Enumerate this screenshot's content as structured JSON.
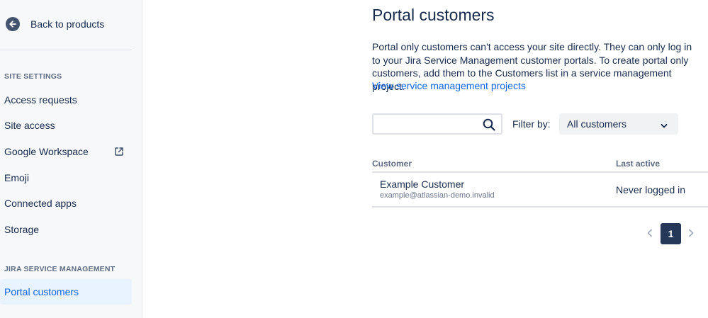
{
  "sidebar": {
    "back_label": "Back to products",
    "sections": [
      {
        "title": "SITE SETTINGS",
        "items": [
          {
            "label": "Access requests"
          },
          {
            "label": "Site access"
          },
          {
            "label": "Google Workspace",
            "icon": "external-link-icon"
          },
          {
            "label": "Emoji"
          },
          {
            "label": "Connected apps"
          },
          {
            "label": "Storage"
          }
        ]
      },
      {
        "title": "JIRA SERVICE MANAGEMENT",
        "items": [
          {
            "label": "Portal customers",
            "active": true
          }
        ]
      }
    ]
  },
  "main": {
    "title": "Portal customers",
    "description": "Portal only customers can't access your site directly. They can only log in to your Jira Service Management customer portals. To create portal only customers, add them to the Customers list in a service management project.",
    "link_label": "View service management projects",
    "search": {
      "placeholder": "",
      "value": ""
    },
    "filter_label": "Filter by:",
    "filter_value": "All customers",
    "table": {
      "headers": [
        "Customer",
        "Last active"
      ],
      "rows": [
        {
          "name": "Example Customer",
          "email": "example@atlassian-demo.invalid",
          "last_active": "Never logged in"
        }
      ]
    },
    "pagination": {
      "current_page": "1"
    }
  },
  "colors": {
    "link": "#0c66e4",
    "active_bg": "#e9f2ff",
    "page_button": "#253858",
    "sidebar_bg": "#f7f8f9"
  }
}
